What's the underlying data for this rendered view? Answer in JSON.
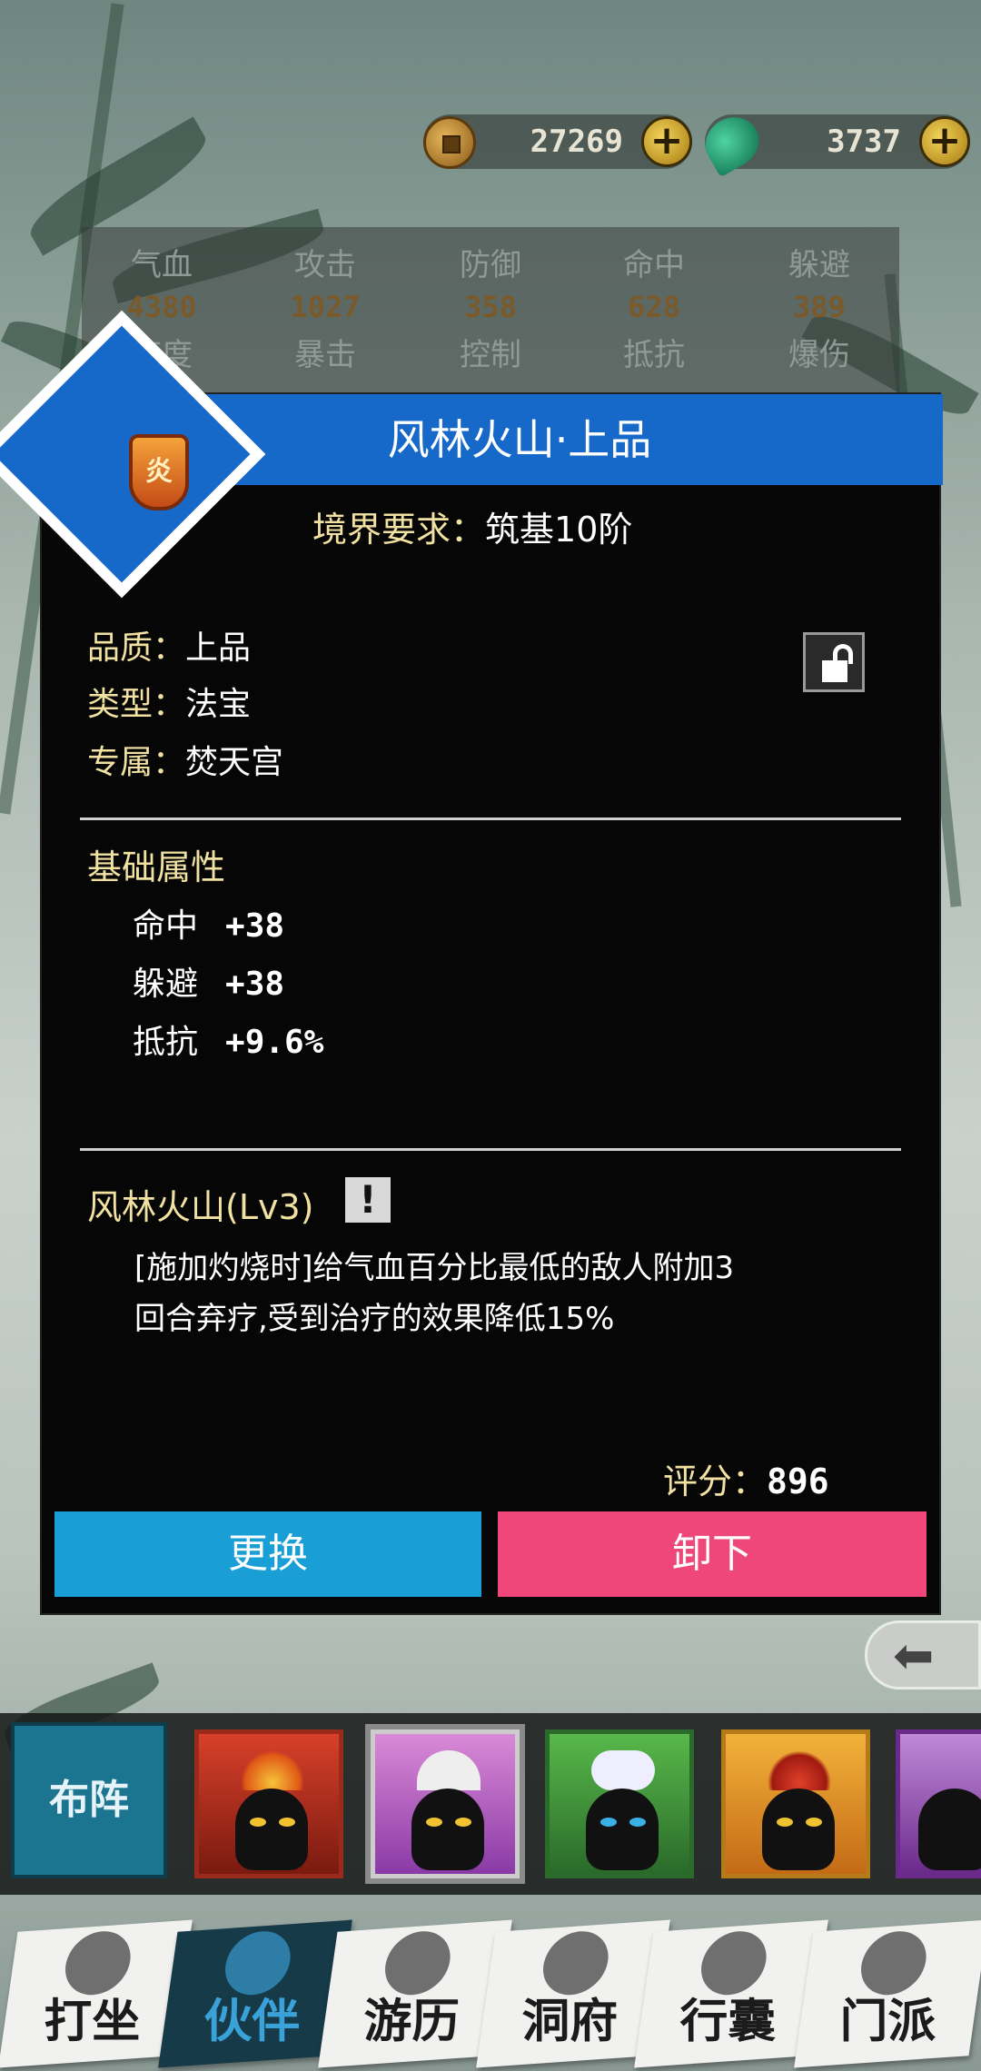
{
  "currency": {
    "coins": "27269",
    "jade": "3737"
  },
  "stats": [
    {
      "label": "气血",
      "value": "4380"
    },
    {
      "label": "攻击",
      "value": "1027"
    },
    {
      "label": "防御",
      "value": "358"
    },
    {
      "label": "命中",
      "value": "628"
    },
    {
      "label": "躲避",
      "value": "389"
    }
  ],
  "stats_row2": [
    "速度",
    "暴击",
    "控制",
    "抵抗",
    "爆伤"
  ],
  "item": {
    "title": "风林火山·上品",
    "emblem_char": "炎",
    "requirement_label": "境界要求：",
    "requirement_value": "筑基10阶",
    "quality_label": "品质：",
    "quality_value": "上品",
    "type_label": "类型：",
    "type_value": "法宝",
    "exclusive_label": "专属：",
    "exclusive_value": "焚天宫",
    "base_attr_title": "基础属性",
    "attrs": [
      {
        "name": "命中",
        "value": "+38"
      },
      {
        "name": "躲避",
        "value": "+38"
      },
      {
        "name": "抵抗",
        "value": "+9.6%"
      }
    ],
    "skill_name": "风林火山(Lv3)",
    "skill_desc_line1": "[施加灼烧时]给气血百分比最低的敌人附加3",
    "skill_desc_line2": "回合弃疗,受到治疗的效果降低15%",
    "score_label": "评分：",
    "score_value": "896",
    "btn_swap": "更换",
    "btn_unload": "卸下"
  },
  "roster": {
    "formation_label": "布阵"
  },
  "nav": [
    "打坐",
    "伙伴",
    "游历",
    "洞府",
    "行囊",
    "门派"
  ],
  "colors": {
    "title_blue": "#1769c9",
    "swap_blue": "#1a9ed6",
    "unload_pink": "#f0477a",
    "label_gold": "#f2e2a2"
  }
}
